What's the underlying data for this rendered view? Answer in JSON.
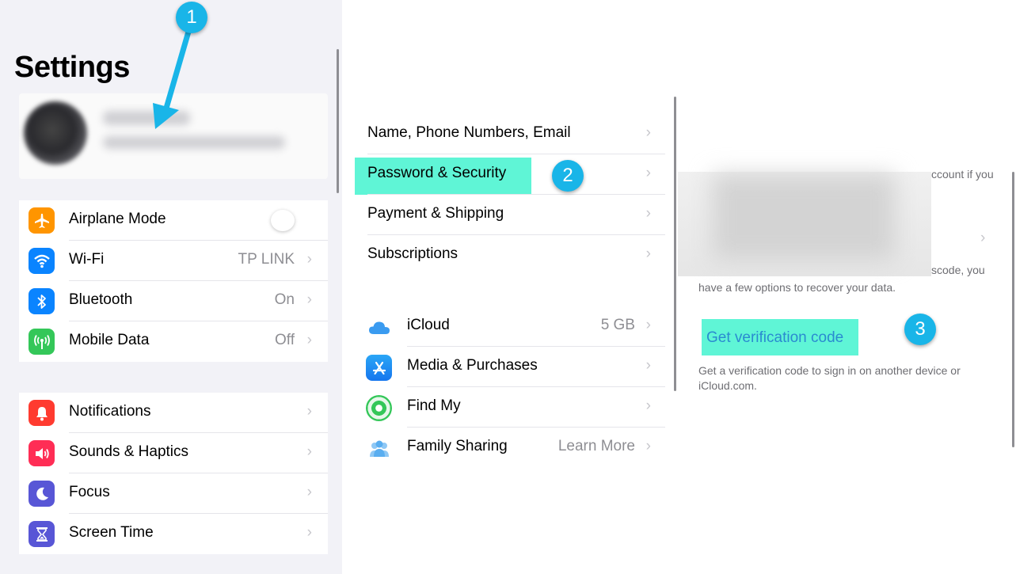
{
  "settings": {
    "title": "Settings",
    "group1": [
      {
        "label": "Airplane Mode",
        "icon": "airplane-icon",
        "color": "#ff9500",
        "value": ""
      },
      {
        "label": "Wi-Fi",
        "icon": "wifi-icon",
        "color": "#0a84ff",
        "value": "TP LINK"
      },
      {
        "label": "Bluetooth",
        "icon": "bluetooth-icon",
        "color": "#0a84ff",
        "value": "On"
      },
      {
        "label": "Mobile Data",
        "icon": "antenna-icon",
        "color": "#34c759",
        "value": "Off"
      }
    ],
    "group2": [
      {
        "label": "Notifications",
        "icon": "bell-icon",
        "color": "#ff3b30"
      },
      {
        "label": "Sounds & Haptics",
        "icon": "speaker-icon",
        "color": "#ff2d55"
      },
      {
        "label": "Focus",
        "icon": "moon-icon",
        "color": "#5856d6"
      },
      {
        "label": "Screen Time",
        "icon": "hourglass-icon",
        "color": "#5856d6"
      }
    ]
  },
  "apple_id": {
    "group1": [
      {
        "label": "Name, Phone Numbers, Email"
      },
      {
        "label": "Password & Security"
      },
      {
        "label": "Payment & Shipping"
      },
      {
        "label": "Subscriptions"
      }
    ],
    "group2": [
      {
        "label": "iCloud",
        "value": "5 GB",
        "icon": "cloud-icon"
      },
      {
        "label": "Media & Purchases",
        "value": "",
        "icon": "app-store-icon"
      },
      {
        "label": "Find My",
        "value": "",
        "icon": "find-my-icon"
      },
      {
        "label": "Family Sharing",
        "value": "Learn More",
        "icon": "family-icon"
      }
    ]
  },
  "security": {
    "text_top_fragment": "ccount if you",
    "text_mid_fragment": "scode, you",
    "text_recover": "have a few options to recover your data.",
    "link": "Get verification code",
    "description": "Get a verification code to sign in on another device or iCloud.com."
  },
  "badges": [
    "1",
    "2",
    "3"
  ],
  "colors": {
    "highlight": "#5ff5d6",
    "badge": "#19b5e8",
    "arrow": "#19b5e8",
    "link": "#2a8bd0"
  }
}
